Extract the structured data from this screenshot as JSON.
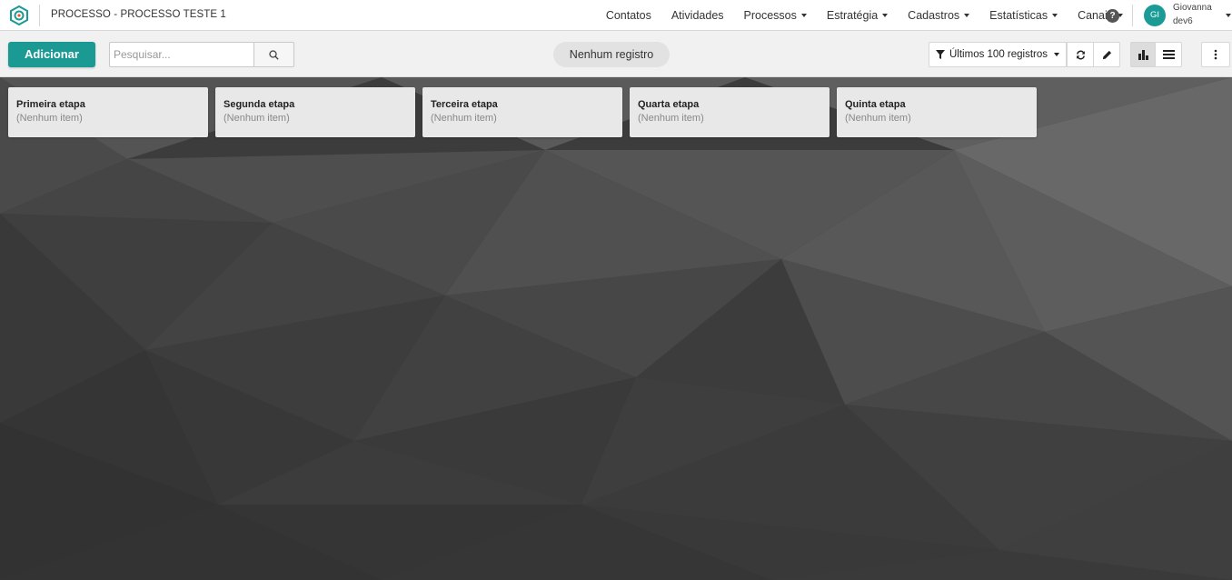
{
  "header": {
    "process_title": "PROCESSO - PROCESSO TESTE 1",
    "menu": [
      {
        "label": "Contatos",
        "dropdown": false
      },
      {
        "label": "Atividades",
        "dropdown": false
      },
      {
        "label": "Processos",
        "dropdown": true
      },
      {
        "label": "Estratégia",
        "dropdown": true
      },
      {
        "label": "Cadastros",
        "dropdown": true
      },
      {
        "label": "Estatísticas",
        "dropdown": true
      },
      {
        "label": "Canais",
        "dropdown": true
      }
    ],
    "help_icon": "question-circle-icon",
    "user": {
      "initials": "GI",
      "name": "Giovanna",
      "subtitle": "dev6",
      "avatar_color": "#1a9b95"
    }
  },
  "toolbar": {
    "add_label": "Adicionar",
    "search_placeholder": "Pesquisar...",
    "status_text": "Nenhum registro",
    "filter_label": "Últimos 100 registros"
  },
  "stages": [
    {
      "title": "Primeira etapa",
      "empty_text": "(Nenhum item)"
    },
    {
      "title": "Segunda etapa",
      "empty_text": "(Nenhum item)"
    },
    {
      "title": "Terceira etapa",
      "empty_text": "(Nenhum item)"
    },
    {
      "title": "Quarta etapa",
      "empty_text": "(Nenhum item)"
    },
    {
      "title": "Quinta etapa",
      "empty_text": "(Nenhum item)"
    }
  ],
  "colors": {
    "accent": "#1b9a94",
    "board_background": "#3d3d3d"
  }
}
